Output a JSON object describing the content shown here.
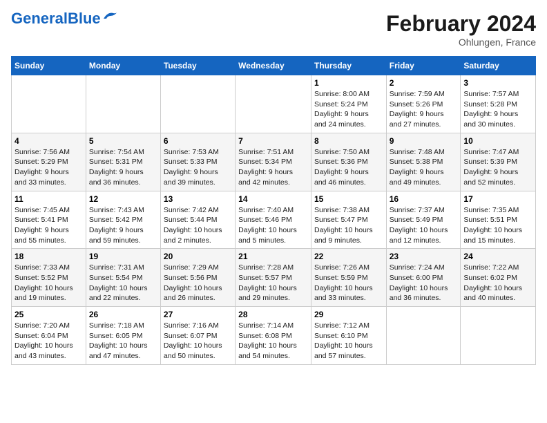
{
  "header": {
    "logo_line1": "General",
    "logo_line2": "Blue",
    "month": "February 2024",
    "location": "Ohlungen, France"
  },
  "days_of_week": [
    "Sunday",
    "Monday",
    "Tuesday",
    "Wednesday",
    "Thursday",
    "Friday",
    "Saturday"
  ],
  "weeks": [
    [
      {
        "day": "",
        "info": ""
      },
      {
        "day": "",
        "info": ""
      },
      {
        "day": "",
        "info": ""
      },
      {
        "day": "",
        "info": ""
      },
      {
        "day": "1",
        "info": "Sunrise: 8:00 AM\nSunset: 5:24 PM\nDaylight: 9 hours\nand 24 minutes."
      },
      {
        "day": "2",
        "info": "Sunrise: 7:59 AM\nSunset: 5:26 PM\nDaylight: 9 hours\nand 27 minutes."
      },
      {
        "day": "3",
        "info": "Sunrise: 7:57 AM\nSunset: 5:28 PM\nDaylight: 9 hours\nand 30 minutes."
      }
    ],
    [
      {
        "day": "4",
        "info": "Sunrise: 7:56 AM\nSunset: 5:29 PM\nDaylight: 9 hours\nand 33 minutes."
      },
      {
        "day": "5",
        "info": "Sunrise: 7:54 AM\nSunset: 5:31 PM\nDaylight: 9 hours\nand 36 minutes."
      },
      {
        "day": "6",
        "info": "Sunrise: 7:53 AM\nSunset: 5:33 PM\nDaylight: 9 hours\nand 39 minutes."
      },
      {
        "day": "7",
        "info": "Sunrise: 7:51 AM\nSunset: 5:34 PM\nDaylight: 9 hours\nand 42 minutes."
      },
      {
        "day": "8",
        "info": "Sunrise: 7:50 AM\nSunset: 5:36 PM\nDaylight: 9 hours\nand 46 minutes."
      },
      {
        "day": "9",
        "info": "Sunrise: 7:48 AM\nSunset: 5:38 PM\nDaylight: 9 hours\nand 49 minutes."
      },
      {
        "day": "10",
        "info": "Sunrise: 7:47 AM\nSunset: 5:39 PM\nDaylight: 9 hours\nand 52 minutes."
      }
    ],
    [
      {
        "day": "11",
        "info": "Sunrise: 7:45 AM\nSunset: 5:41 PM\nDaylight: 9 hours\nand 55 minutes."
      },
      {
        "day": "12",
        "info": "Sunrise: 7:43 AM\nSunset: 5:42 PM\nDaylight: 9 hours\nand 59 minutes."
      },
      {
        "day": "13",
        "info": "Sunrise: 7:42 AM\nSunset: 5:44 PM\nDaylight: 10 hours\nand 2 minutes."
      },
      {
        "day": "14",
        "info": "Sunrise: 7:40 AM\nSunset: 5:46 PM\nDaylight: 10 hours\nand 5 minutes."
      },
      {
        "day": "15",
        "info": "Sunrise: 7:38 AM\nSunset: 5:47 PM\nDaylight: 10 hours\nand 9 minutes."
      },
      {
        "day": "16",
        "info": "Sunrise: 7:37 AM\nSunset: 5:49 PM\nDaylight: 10 hours\nand 12 minutes."
      },
      {
        "day": "17",
        "info": "Sunrise: 7:35 AM\nSunset: 5:51 PM\nDaylight: 10 hours\nand 15 minutes."
      }
    ],
    [
      {
        "day": "18",
        "info": "Sunrise: 7:33 AM\nSunset: 5:52 PM\nDaylight: 10 hours\nand 19 minutes."
      },
      {
        "day": "19",
        "info": "Sunrise: 7:31 AM\nSunset: 5:54 PM\nDaylight: 10 hours\nand 22 minutes."
      },
      {
        "day": "20",
        "info": "Sunrise: 7:29 AM\nSunset: 5:56 PM\nDaylight: 10 hours\nand 26 minutes."
      },
      {
        "day": "21",
        "info": "Sunrise: 7:28 AM\nSunset: 5:57 PM\nDaylight: 10 hours\nand 29 minutes."
      },
      {
        "day": "22",
        "info": "Sunrise: 7:26 AM\nSunset: 5:59 PM\nDaylight: 10 hours\nand 33 minutes."
      },
      {
        "day": "23",
        "info": "Sunrise: 7:24 AM\nSunset: 6:00 PM\nDaylight: 10 hours\nand 36 minutes."
      },
      {
        "day": "24",
        "info": "Sunrise: 7:22 AM\nSunset: 6:02 PM\nDaylight: 10 hours\nand 40 minutes."
      }
    ],
    [
      {
        "day": "25",
        "info": "Sunrise: 7:20 AM\nSunset: 6:04 PM\nDaylight: 10 hours\nand 43 minutes."
      },
      {
        "day": "26",
        "info": "Sunrise: 7:18 AM\nSunset: 6:05 PM\nDaylight: 10 hours\nand 47 minutes."
      },
      {
        "day": "27",
        "info": "Sunrise: 7:16 AM\nSunset: 6:07 PM\nDaylight: 10 hours\nand 50 minutes."
      },
      {
        "day": "28",
        "info": "Sunrise: 7:14 AM\nSunset: 6:08 PM\nDaylight: 10 hours\nand 54 minutes."
      },
      {
        "day": "29",
        "info": "Sunrise: 7:12 AM\nSunset: 6:10 PM\nDaylight: 10 hours\nand 57 minutes."
      },
      {
        "day": "",
        "info": ""
      },
      {
        "day": "",
        "info": ""
      }
    ]
  ]
}
